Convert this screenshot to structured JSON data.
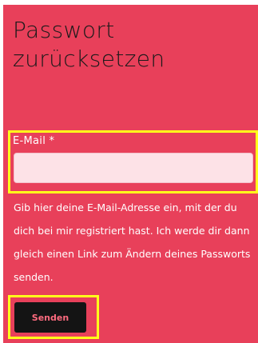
{
  "form": {
    "title": "Passwort zurücksetzen",
    "email_label": "E-Mail *",
    "email_value": "",
    "email_placeholder": "",
    "help_text": "Gib hier deine E-Mail-Adresse ein, mit der du dich bei mir registriert hast. Ich werde dir dann gleich einen Link zum Ändern deines Passworts senden.",
    "submit_label": "Senden"
  },
  "colors": {
    "panel_background": "#e8405a",
    "input_background": "#fde2e7",
    "button_background": "#141414",
    "button_text": "#ff6b7f",
    "highlight_outline": "#ffff1a"
  }
}
